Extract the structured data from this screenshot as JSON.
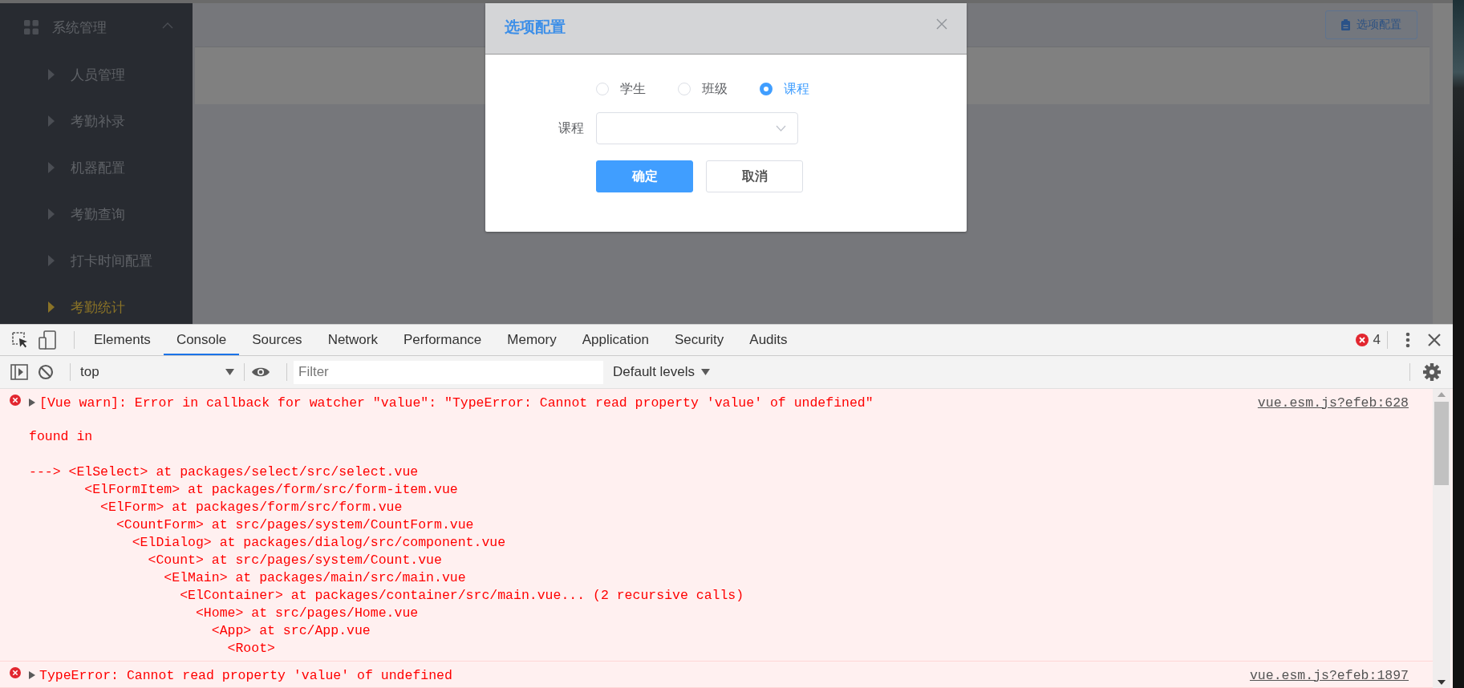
{
  "sidebar": {
    "menu": {
      "label": "系统管理",
      "expanded": true,
      "items": [
        {
          "label": "人员管理",
          "selected": false
        },
        {
          "label": "考勤补录",
          "selected": false
        },
        {
          "label": "机器配置",
          "selected": false
        },
        {
          "label": "考勤查询",
          "selected": false
        },
        {
          "label": "打卡时间配置",
          "selected": false
        },
        {
          "label": "考勤统计",
          "selected": true
        }
      ]
    }
  },
  "header_button": {
    "label": "选项配置"
  },
  "dialog": {
    "title": "选项配置",
    "radios": [
      {
        "label": "学生",
        "selected": false
      },
      {
        "label": "班级",
        "selected": false
      },
      {
        "label": "课程",
        "selected": true
      }
    ],
    "field": {
      "label": "课程"
    },
    "buttons": [
      {
        "label": "确定",
        "kind": "primary"
      },
      {
        "label": "取消",
        "kind": "default"
      }
    ]
  },
  "devtools": {
    "tabs": [
      {
        "label": "Elements",
        "selected": false
      },
      {
        "label": "Console",
        "selected": true
      },
      {
        "label": "Sources",
        "selected": false
      },
      {
        "label": "Network",
        "selected": false
      },
      {
        "label": "Performance",
        "selected": false
      },
      {
        "label": "Memory",
        "selected": false
      },
      {
        "label": "Application",
        "selected": false
      },
      {
        "label": "Security",
        "selected": false
      },
      {
        "label": "Audits",
        "selected": false
      }
    ],
    "error_count": "4",
    "context": "top",
    "filter": {
      "placeholder": "Filter"
    },
    "levels": "Default levels",
    "messages": [
      {
        "kind": "error",
        "expanded": false,
        "text": "[Vue warn]: Error in callback for watcher \"value\": \"TypeError: Cannot read property 'value' of undefined\"",
        "source": "vue.esm.js?efeb:628",
        "found_in": "found in",
        "trace": [
          "---> <ElSelect> at packages/select/src/select.vue",
          "       <ElFormItem> at packages/form/src/form-item.vue",
          "         <ElForm> at packages/form/src/form.vue",
          "           <CountForm> at src/pages/system/CountForm.vue",
          "             <ElDialog> at packages/dialog/src/component.vue",
          "               <Count> at src/pages/system/Count.vue",
          "                 <ElMain> at packages/main/src/main.vue",
          "                   <ElContainer> at packages/container/src/main.vue... (2 recursive calls)",
          "                     <Home> at src/pages/Home.vue",
          "                       <App> at src/App.vue",
          "                         <Root>"
        ]
      },
      {
        "kind": "error",
        "expanded": false,
        "text": "TypeError: Cannot read property 'value' of undefined",
        "source": "vue.esm.js?efeb:1897"
      }
    ]
  }
}
